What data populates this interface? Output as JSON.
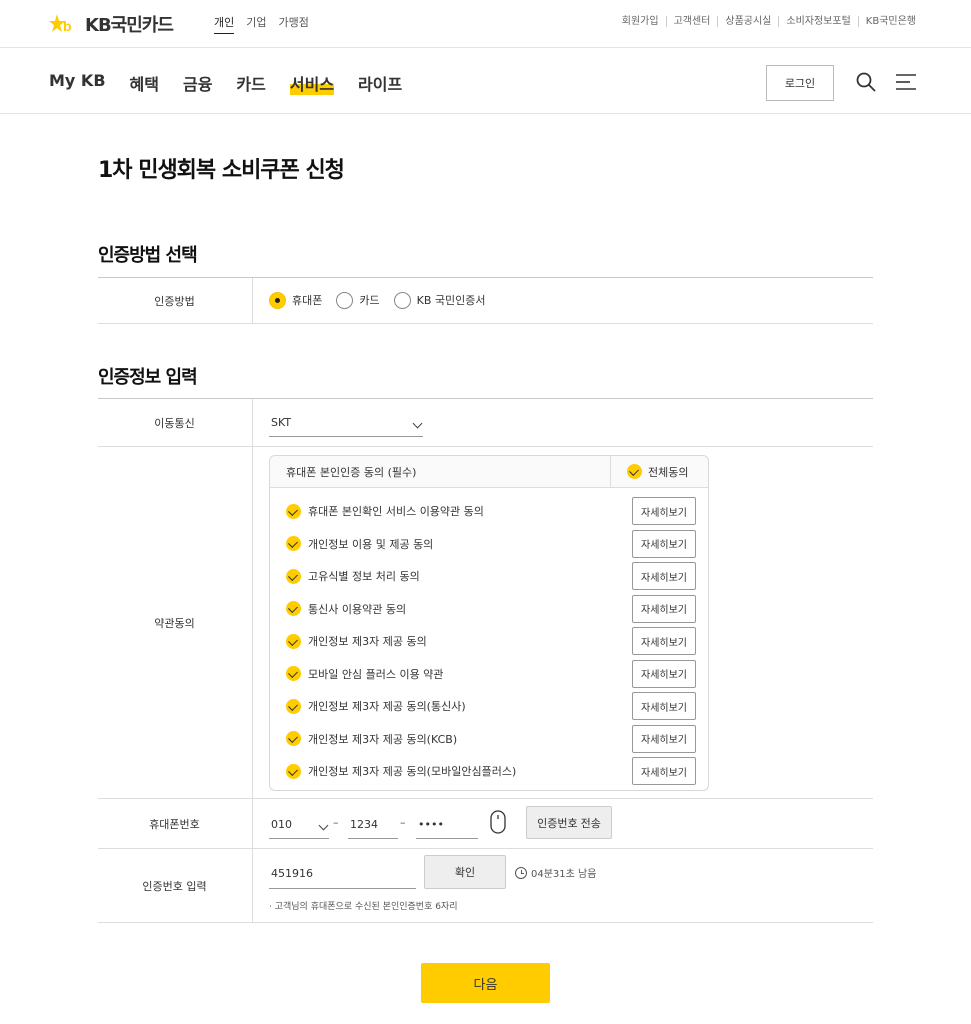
{
  "brand": {
    "name": "KB국민카드",
    "accent": "#ffcc00"
  },
  "segment_tabs": [
    "개인",
    "기업",
    "가맹점"
  ],
  "util_links": [
    "회원가입",
    "고객센터",
    "상품공시실",
    "소비자정보포털",
    "KB국민은행"
  ],
  "gnb": [
    "My KB",
    "혜택",
    "금융",
    "카드",
    "서비스",
    "라이프"
  ],
  "login_label": "로그인",
  "page_title": "1차 민생회복 소비쿠폰 신청",
  "auth_method": {
    "section_title": "인증방법 선택",
    "label": "인증방법",
    "options": [
      "휴대폰",
      "카드",
      "KB 국민인증서"
    ],
    "selected": "휴대폰"
  },
  "auth_info": {
    "section_title": "인증정보 입력",
    "carrier_label": "이동통신",
    "carrier_value": "SKT",
    "terms_label": "약관동의",
    "terms_header": "휴대폰 본인인증 동의 (필수)",
    "agree_all": "전체동의",
    "detail_label": "자세히보기",
    "terms": [
      "휴대폰 본인확인 서비스 이용약관 동의",
      "개인정보 이용 및 제공 동의",
      "고유식별 정보 처리 동의",
      "통신사 이용약관 동의",
      "개인정보 제3자 제공 동의",
      "모바일 안심 플러스 이용 약관",
      "개인정보 제3자 제공 동의(통신사)",
      "개인정보 제3자 제공 동의(KCB)",
      "개인정보 제3자 제공 동의(모바일안심플러스)"
    ],
    "phone_label": "휴대폰번호",
    "phone_prefix": "010",
    "phone_mid": "1234",
    "phone_last": "••••",
    "send_code_label": "인증번호 전송",
    "code_label": "인증번호 입력",
    "code_value": "451916",
    "confirm_label": "확인",
    "timer_text": "04분31초 남음",
    "note": "· 고객님의 휴대폰으로 수신된 본인인증번호 6자리"
  },
  "next_label": "다음"
}
